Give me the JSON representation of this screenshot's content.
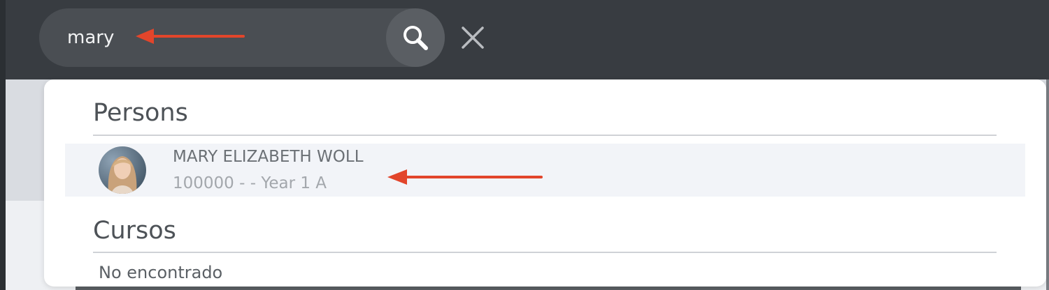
{
  "search": {
    "value": "mary",
    "placeholder": ""
  },
  "icons": {
    "search": "search-icon",
    "close": "close-icon",
    "annotation_arrow": "arrow-left-icon"
  },
  "results": {
    "persons_heading": "Persons",
    "persons": [
      {
        "name": "MARY ELIZABETH WOLL",
        "subtitle": "100000 - - Year 1 A"
      }
    ],
    "courses_heading": "Cursos",
    "courses_empty": "No encontrado"
  },
  "colors": {
    "annotation_arrow": "#e2452b",
    "topbar": "#383c41",
    "search_pill": "#4a4e53",
    "row_highlight": "#f2f4f8"
  }
}
